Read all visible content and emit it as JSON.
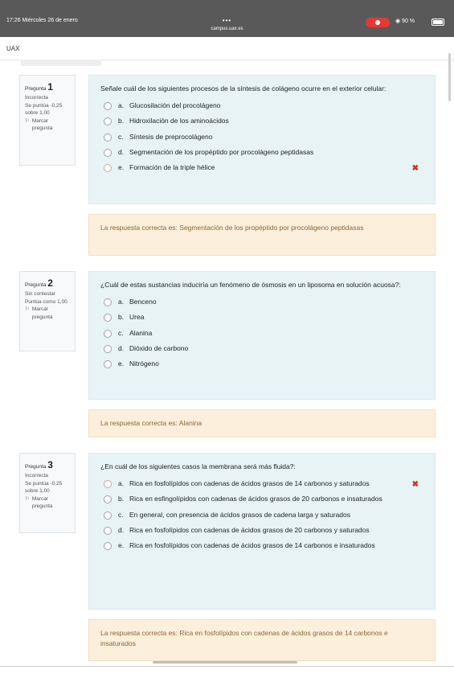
{
  "status_bar": {
    "time": "17:26  Miércoles 26 de enero",
    "url": "campus.uax.es",
    "indicators": "◉ 90 %",
    "dots": "•••"
  },
  "site": {
    "brand": "UAX"
  },
  "questions": [
    {
      "number_label": "Pregunta",
      "number": "1",
      "state": "Incorrecta",
      "grade": "Se puntúa -0,25 sobre 1,00",
      "flag_label": "Marcar pregunta",
      "text": "Señale cuál de los siguientes procesos de la síntesis de colágeno ocurre en el exterior celular:",
      "answers": [
        {
          "letter": "a.",
          "text": "Glucosilación del procolágeno",
          "selected": false,
          "wrong": false
        },
        {
          "letter": "b.",
          "text": "Hidroxilación de los aminoácidos",
          "selected": false,
          "wrong": false
        },
        {
          "letter": "c.",
          "text": "Síntesis de preprocolágeno",
          "selected": false,
          "wrong": false
        },
        {
          "letter": "d.",
          "text": "Segmentación de los propéptido por procolágeno peptidasas",
          "selected": false,
          "wrong": false
        },
        {
          "letter": "e.",
          "text": "Formación de la triple hélice",
          "selected": true,
          "wrong": true
        }
      ],
      "feedback": "La respuesta correcta es: Segmentación de los propéptido por procolágeno peptidasas"
    },
    {
      "number_label": "Pregunta",
      "number": "2",
      "state": "Sin contestar",
      "grade": "Puntúa como 1,00",
      "flag_label": "Marcar pregunta",
      "text": "¿Cuál de estas sustancias induciría un fenómeno de ósmosis en un liposoma en solución acuosa?:",
      "answers": [
        {
          "letter": "a.",
          "text": "Benceno",
          "selected": false,
          "wrong": false
        },
        {
          "letter": "b.",
          "text": "Urea",
          "selected": false,
          "wrong": false
        },
        {
          "letter": "c.",
          "text": "Alanina",
          "selected": false,
          "wrong": false
        },
        {
          "letter": "d.",
          "text": "Dióxido de carbono",
          "selected": false,
          "wrong": false
        },
        {
          "letter": "e.",
          "text": "Nitrógeno",
          "selected": false,
          "wrong": false
        }
      ],
      "feedback": "La respuesta correcta es: Alanina"
    },
    {
      "number_label": "Pregunta",
      "number": "3",
      "state": "Incorrecta",
      "grade": "Se puntúa -0,25 sobre 1,00",
      "flag_label": "Marcar pregunta",
      "text": "¿En cuál de los siguientes casos la membrana será más fluida?:",
      "answers": [
        {
          "letter": "a.",
          "text": "Rica en fosfolípidos con cadenas de ácidos grasos de 14 carbonos y saturados",
          "selected": true,
          "wrong": true
        },
        {
          "letter": "b.",
          "text": "Rica en esfingolípidos con cadenas de ácidos grasos de 20 carbonos e insaturados",
          "selected": false,
          "wrong": false
        },
        {
          "letter": "c.",
          "text": "En general, con presencia de ácidos grasos de cadena larga y saturados",
          "selected": false,
          "wrong": false
        },
        {
          "letter": "d.",
          "text": "Rica en fosfolípidos con cadenas de ácidos grasos de 20 carbonos y saturados",
          "selected": false,
          "wrong": false
        },
        {
          "letter": "e.",
          "text": "Rica en fosfolípidos con cadenas de ácidos grasos de 14 carbonos e insaturados",
          "selected": false,
          "wrong": false
        }
      ],
      "feedback": "La respuesta correcta es: Rica en fosfolípidos con cadenas de ácidos grasos de 14 carbonos e insaturados"
    }
  ],
  "icons": {
    "wrong": "✖",
    "flag": "⚐"
  }
}
